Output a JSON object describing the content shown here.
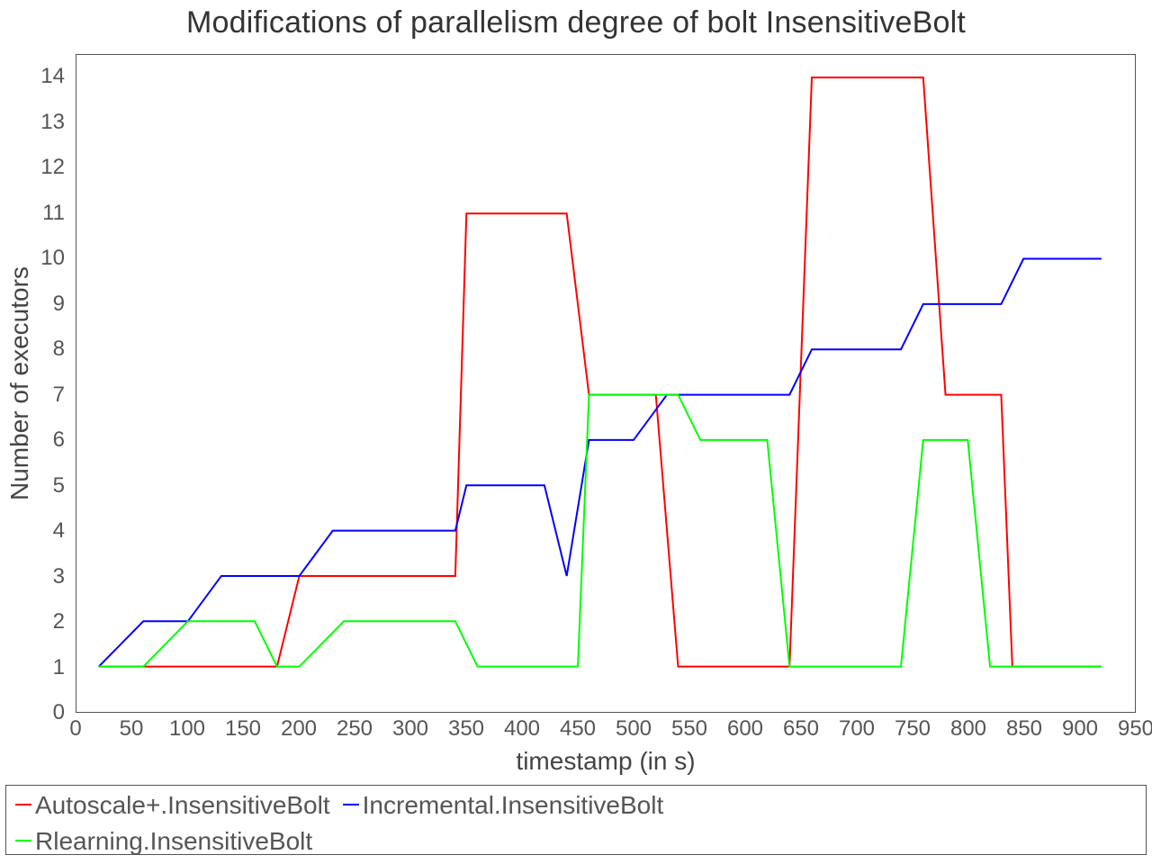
{
  "chart_data": {
    "type": "line",
    "title": "Modifications of parallelism degree of bolt InsensitiveBolt",
    "xlabel": "timestamp (in s)",
    "ylabel": "Number of executors",
    "xlim": [
      0,
      950
    ],
    "ylim": [
      0,
      14.5
    ],
    "x_ticks": [
      0,
      50,
      100,
      150,
      200,
      250,
      300,
      350,
      400,
      450,
      500,
      550,
      600,
      650,
      700,
      750,
      800,
      850,
      900,
      950
    ],
    "y_ticks": [
      0,
      1,
      2,
      3,
      4,
      5,
      6,
      7,
      8,
      9,
      10,
      11,
      12,
      13,
      14
    ],
    "legend_position": "bottom",
    "colors": {
      "Autoscale+.InsensitiveBolt": "#ff0000",
      "Incremental.InsensitiveBolt": "#0000ff",
      "Rlearning.InsensitiveBolt": "#00ff00"
    },
    "series": [
      {
        "name": "Autoscale+.InsensitiveBolt",
        "color": "#ff0000",
        "x": [
          20,
          60,
          100,
          150,
          180,
          200,
          250,
          300,
          340,
          350,
          400,
          440,
          460,
          480,
          520,
          540,
          560,
          600,
          640,
          660,
          680,
          720,
          760,
          780,
          800,
          830,
          840,
          860,
          900,
          920
        ],
        "y": [
          1,
          1,
          1,
          1,
          1,
          3,
          3,
          3,
          3,
          11,
          11,
          11,
          7,
          7,
          7,
          1,
          1,
          1,
          1,
          14,
          14,
          14,
          14,
          7,
          7,
          7,
          1,
          1,
          1,
          1
        ]
      },
      {
        "name": "Incremental.InsensitiveBolt",
        "color": "#0000ff",
        "x": [
          20,
          60,
          100,
          130,
          160,
          200,
          230,
          260,
          300,
          340,
          350,
          380,
          420,
          440,
          460,
          480,
          500,
          530,
          560,
          600,
          640,
          660,
          700,
          740,
          760,
          800,
          830,
          850,
          900,
          920
        ],
        "y": [
          1,
          2,
          2,
          3,
          3,
          3,
          4,
          4,
          4,
          4,
          5,
          5,
          5,
          3,
          6,
          6,
          6,
          7,
          7,
          7,
          7,
          8,
          8,
          8,
          9,
          9,
          9,
          10,
          10,
          10
        ]
      },
      {
        "name": "Rlearning.InsensitiveBolt",
        "color": "#00ff00",
        "x": [
          20,
          60,
          100,
          130,
          160,
          180,
          200,
          240,
          260,
          300,
          340,
          360,
          400,
          450,
          460,
          480,
          520,
          540,
          560,
          580,
          620,
          640,
          660,
          700,
          740,
          760,
          800,
          820,
          860,
          920
        ],
        "y": [
          1,
          1,
          2,
          2,
          2,
          1,
          1,
          2,
          2,
          2,
          2,
          1,
          1,
          1,
          7,
          7,
          7,
          7,
          6,
          6,
          6,
          1,
          1,
          1,
          1,
          6,
          6,
          1,
          1,
          1
        ]
      }
    ]
  }
}
